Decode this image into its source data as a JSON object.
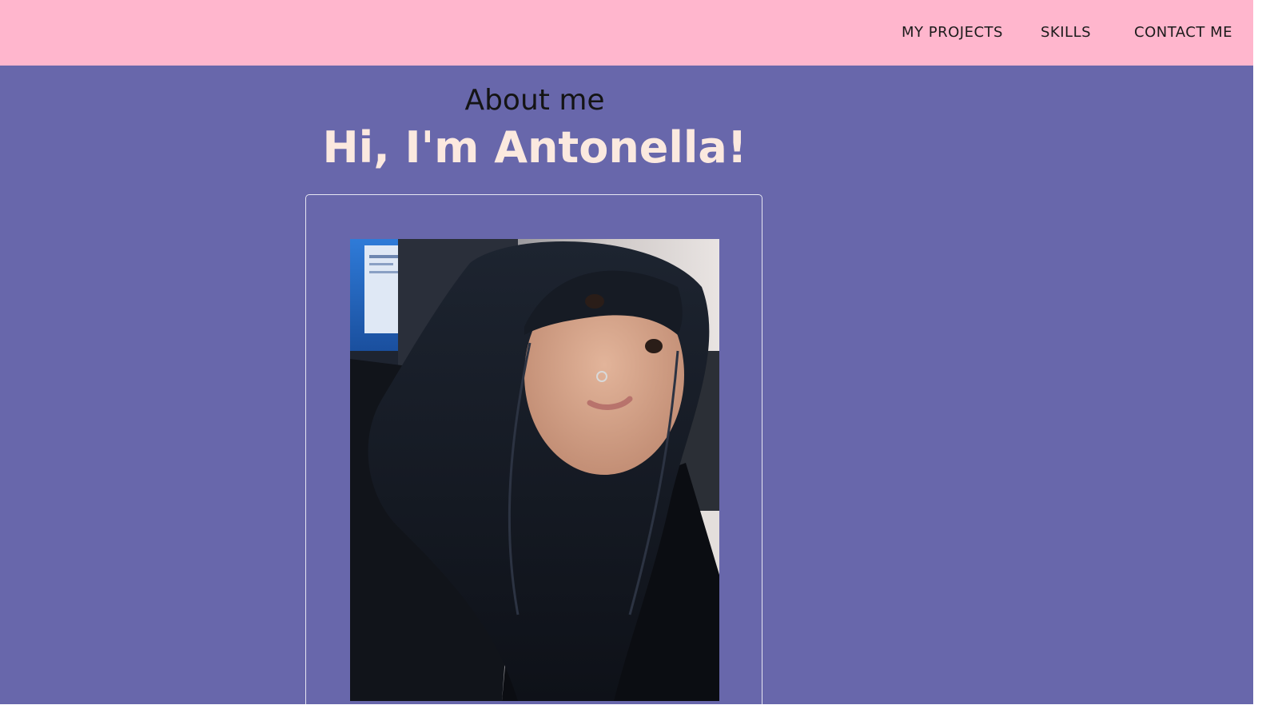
{
  "nav": {
    "links": [
      {
        "label": "MY PROJECTS"
      },
      {
        "label": "SKILLS"
      },
      {
        "label": "CONTACT ME"
      }
    ]
  },
  "about": {
    "section_title": "About me",
    "greeting": "Hi, I'm Antonella!"
  },
  "colors": {
    "nav_background": "#ffb6cd",
    "main_background": "#6867ab",
    "greeting_text": "#fbe9df"
  }
}
